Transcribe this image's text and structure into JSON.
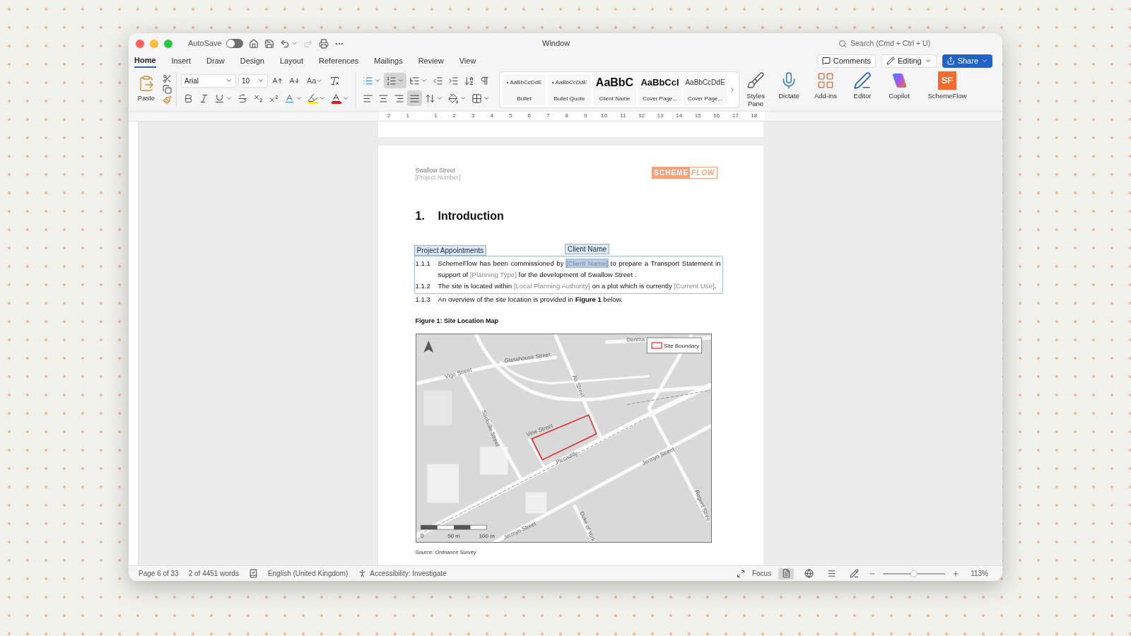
{
  "window": {
    "title": "Window",
    "autosave": {
      "label": "AutoSave",
      "on": false
    },
    "search": {
      "placeholder": "Search (Cmd + Ctrl + U)"
    }
  },
  "tabs": [
    {
      "label": "Home",
      "selected": true
    },
    {
      "label": "Insert",
      "selected": false
    },
    {
      "label": "Draw",
      "selected": false
    },
    {
      "label": "Design",
      "selected": false
    },
    {
      "label": "Layout",
      "selected": false
    },
    {
      "label": "References",
      "selected": false
    },
    {
      "label": "Mailings",
      "selected": false
    },
    {
      "label": "Review",
      "selected": false
    },
    {
      "label": "View",
      "selected": false
    }
  ],
  "actions": {
    "comments": "Comments",
    "editing": "Editing",
    "share": "Share"
  },
  "ribbon": {
    "paste": "Paste",
    "font": "Arial",
    "size": "10",
    "case": "Aa",
    "numbering": true,
    "justify": true,
    "styles": [
      {
        "preview": "• AaBbCcDdE",
        "name": "Bullet",
        "kind": "bullet"
      },
      {
        "preview": "• AaBbCcDdE",
        "name": "Bullet Quote",
        "kind": "quote"
      },
      {
        "preview": "AaBbC",
        "name": "Client Name",
        "kind": "heading"
      },
      {
        "preview": "AaBbCcI",
        "name": "Cover Page...",
        "kind": "cover_bold"
      },
      {
        "preview": "AaBbCcDdE",
        "name": "Cover Page...",
        "kind": "cover"
      }
    ],
    "tools": [
      {
        "label": "Styles Pane",
        "kind": "styles"
      },
      {
        "label": "Dictate",
        "kind": "dictate"
      },
      {
        "label": "Add-ins",
        "kind": "addins"
      },
      {
        "label": "Editor",
        "kind": "editor"
      },
      {
        "label": "Copilot",
        "kind": "copilot"
      },
      {
        "label": "SchemeFlow",
        "kind": "schemeflow",
        "badge": "SF"
      }
    ]
  },
  "ruler": {
    "before": [
      "2",
      "1"
    ],
    "after": [
      "1",
      "2",
      "3",
      "4",
      "5",
      "6",
      "7",
      "8",
      "9",
      "10",
      "11",
      "12",
      "13",
      "14",
      "15",
      "16",
      "17",
      "18"
    ]
  },
  "document": {
    "header": {
      "title": "Swallow Street",
      "number": "[Project Number]",
      "logo": [
        "SCHEME",
        "FLOW"
      ]
    },
    "heading": {
      "number": "1.",
      "text": "Introduction"
    },
    "control": {
      "tag": "Project Appointments",
      "paragraphs": [
        {
          "number": "1.1.1",
          "segments": [
            {
              "kind": "plain",
              "text": "SchemeFlow has been commissioned by "
            },
            {
              "kind": "field",
              "text": "[Client Name]",
              "tag": "Client Name",
              "selected": true
            },
            {
              "kind": "plain",
              "text": " to prepare a Transport Statement in support of "
            },
            {
              "kind": "field",
              "text": "[Planning Type]",
              "selected": false
            },
            {
              "kind": "plain",
              "text": " for the development of Swallow Street ."
            }
          ]
        },
        {
          "number": "1.1.2",
          "segments": [
            {
              "kind": "plain",
              "text": "The site is located within "
            },
            {
              "kind": "field",
              "text": "[Local Planning Authority]",
              "selected": false
            },
            {
              "kind": "plain",
              "text": " on a plot which is  currently "
            },
            {
              "kind": "field",
              "text": "[Current Use]",
              "selected": false
            },
            {
              "kind": "plain",
              "text": "."
            }
          ]
        }
      ]
    },
    "paragraphs": [
      {
        "number": "1.1.3",
        "segments": [
          {
            "kind": "plain",
            "text": "An overview of the site location is provided in "
          },
          {
            "kind": "bold",
            "text": "Figure 1"
          },
          {
            "kind": "plain",
            "text": " below."
          }
        ]
      }
    ],
    "figure": {
      "caption": "Figure 1: Site Location Map",
      "legend": "Site Boundary",
      "scale": [
        "0",
        "50 m",
        "100 m"
      ],
      "streets": [
        "Glasshouse Street",
        "Vigo Street",
        "Air Street",
        "Denma",
        "Sackville Street",
        "Vine Street",
        "Piccadilly",
        "Jermyn Street",
        "Jermyn Street",
        "Duke of York",
        "Regent Stree"
      ],
      "source": "Source: Ordnance Survey"
    }
  },
  "status_bar": {
    "page": "Page 6 of 33",
    "words": "2 of 4451 words",
    "language": "English (United Kingdom)",
    "accessibility": "Accessibility: Investigate",
    "focus": "Focus",
    "views": [
      {
        "kind": "print",
        "selected": true
      },
      {
        "kind": "web",
        "selected": false
      },
      {
        "kind": "outline",
        "selected": false
      },
      {
        "kind": "draft",
        "selected": false
      }
    ],
    "zoom": {
      "level": 0.5,
      "reading": "113%"
    }
  }
}
